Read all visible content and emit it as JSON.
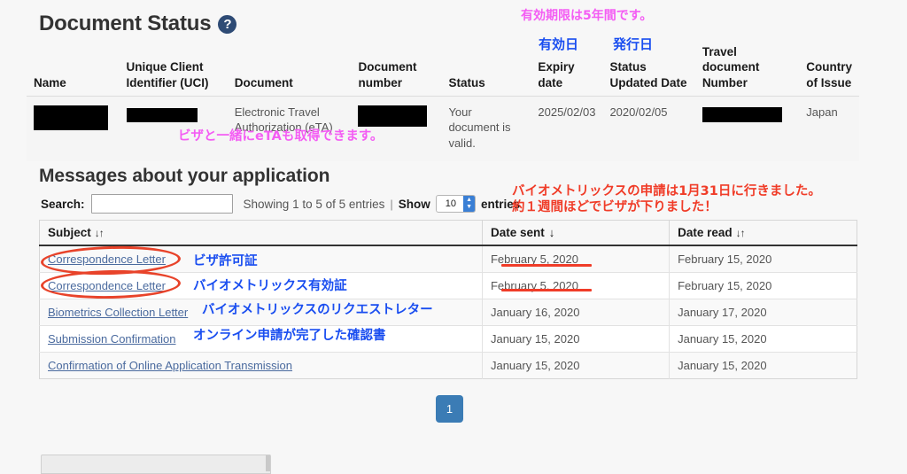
{
  "document_status": {
    "title": "Document Status",
    "help_icon": "question-mark-circle-icon",
    "columns": [
      "Name",
      "Unique Client Identifier (UCI)",
      "Document",
      "Document number",
      "Status",
      "Expiry date",
      "Status Updated Date",
      "Travel document Number",
      "Country of Issue"
    ],
    "row": {
      "name": "",
      "uci": "",
      "document": "Electronic Travel Authorization (eTA)",
      "document_number": "",
      "status": "Your document is valid.",
      "expiry_date": "2025/02/03",
      "status_updated_date": "2020/02/05",
      "travel_document_number": "",
      "country_of_issue": "Japan"
    }
  },
  "messages": {
    "title": "Messages about your application",
    "search_label": "Search:",
    "search_value": "",
    "search_placeholder": "",
    "showing_text": "Showing 1 to 5 of 5 entries",
    "separator": "|",
    "show_word": "Show",
    "entries_count": "10",
    "entries_word": "entries",
    "columns": [
      {
        "label": "Subject",
        "sort": "both",
        "sort_glyph": "↓↑"
      },
      {
        "label": "Date sent",
        "sort": "desc",
        "sort_glyph": "↓"
      },
      {
        "label": "Date read",
        "sort": "both",
        "sort_glyph": "↓↑"
      }
    ],
    "rows": [
      {
        "subject": "Correspondence Letter",
        "date_sent": "February 5, 2020",
        "date_read": "February 15, 2020"
      },
      {
        "subject": "Correspondence Letter",
        "date_sent": "February 5, 2020",
        "date_read": "February 15, 2020"
      },
      {
        "subject": "Biometrics Collection Letter",
        "date_sent": "January 16, 2020",
        "date_read": "January 17, 2020"
      },
      {
        "subject": "Submission Confirmation",
        "date_sent": "January 15, 2020",
        "date_read": "January 15, 2020"
      },
      {
        "subject": "Confirmation of Online Application Transmission",
        "date_sent": "January 15, 2020",
        "date_read": "January 15, 2020"
      }
    ],
    "pagination": {
      "current_page": "1"
    }
  },
  "annotations": {
    "expiry_years": "有効期限は5年間です。",
    "expiry_date_label": "有効日",
    "issue_date_label": "発行日",
    "eta_note": "ビザと一緒にeTAも取得できます。",
    "biometrics_line1": "バイオメトリックスの申請は1月31日に行きました。",
    "biometrics_line2": "約１週間ほどでビザが下りました！",
    "row1_note": "ビザ許可証",
    "row2_note": "バイオメトリックス有効証",
    "row3_note": "バイオメトリックスのリクエストレター",
    "row4_note": "オンライン申請が完了した確認書"
  },
  "colors": {
    "pink": "#f45df4",
    "blue": "#1a4ef0",
    "red": "#f03c28",
    "oval_red": "#e8432a",
    "page_button": "#3b7cb5",
    "link": "#4a6a9e",
    "help_icon": "#2e4b75"
  }
}
